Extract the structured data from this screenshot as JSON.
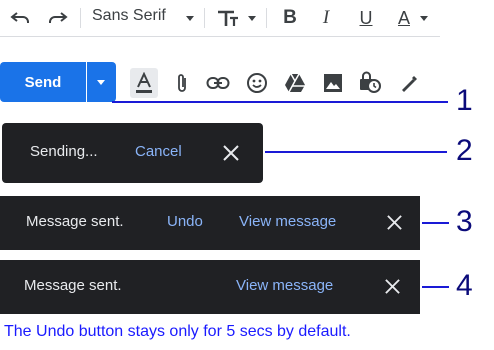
{
  "toolbar": {
    "font_name": "Sans Serif",
    "icons": [
      "undo-icon",
      "redo-icon",
      "font-size-icon",
      "bold-icon",
      "italic-icon",
      "underline-icon",
      "text-color-icon"
    ]
  },
  "compose": {
    "send_label": "Send",
    "icons": [
      "formatting-options-icon",
      "attach-icon",
      "link-icon",
      "emoji-icon",
      "drive-icon",
      "photo-icon",
      "confidential-icon",
      "signature-icon"
    ]
  },
  "snackbars": {
    "sending": {
      "message": "Sending...",
      "action": "Cancel"
    },
    "sent_undo": {
      "message": "Message sent.",
      "undo": "Undo",
      "view": "View message"
    },
    "sent_plain": {
      "message": "Message sent.",
      "view": "View message"
    }
  },
  "annotations": [
    "1",
    "2",
    "3",
    "4"
  ],
  "footnote": "The Undo button stays only for 5 secs by default.",
  "colors": {
    "accent": "#1a73e8",
    "snackbar_bg": "#202124",
    "link": "#8ab4f8",
    "annotation": "#1a1ad6"
  }
}
